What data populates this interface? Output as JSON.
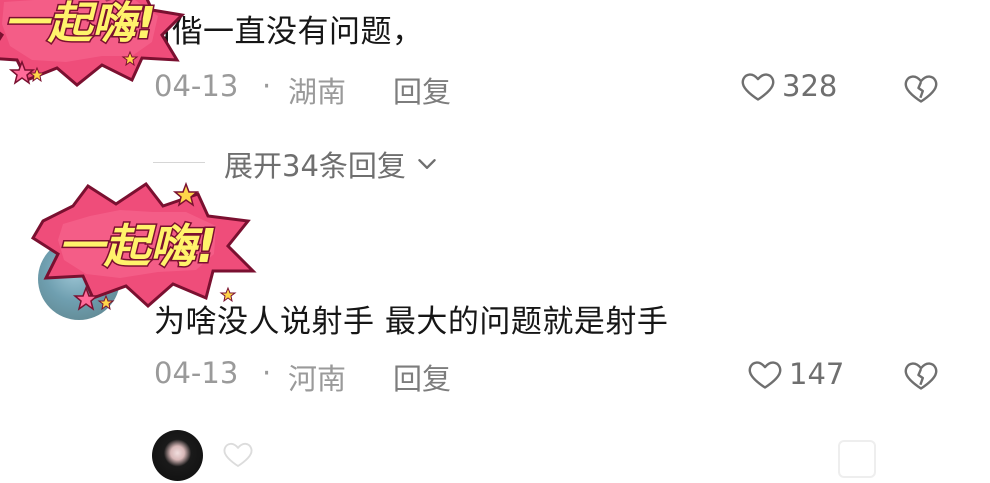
{
  "comment1": {
    "text": "偕偕一直没有问题，",
    "date": "04-13",
    "location": "湖南",
    "reply_label": "回复",
    "like_count": "328"
  },
  "expand": {
    "label": "展开34条回复"
  },
  "comment2": {
    "text": "为啥没人说射手 最大的问题就是射手",
    "date": "04-13",
    "location": "河南",
    "reply_label": "回复",
    "like_count": "147"
  },
  "sticker": {
    "text": "一起嗨!"
  },
  "meta_separator": "·",
  "icons": {
    "like": "heart-outline-icon",
    "dislike": "broken-heart-icon",
    "expand": "chevron-down-icon"
  }
}
